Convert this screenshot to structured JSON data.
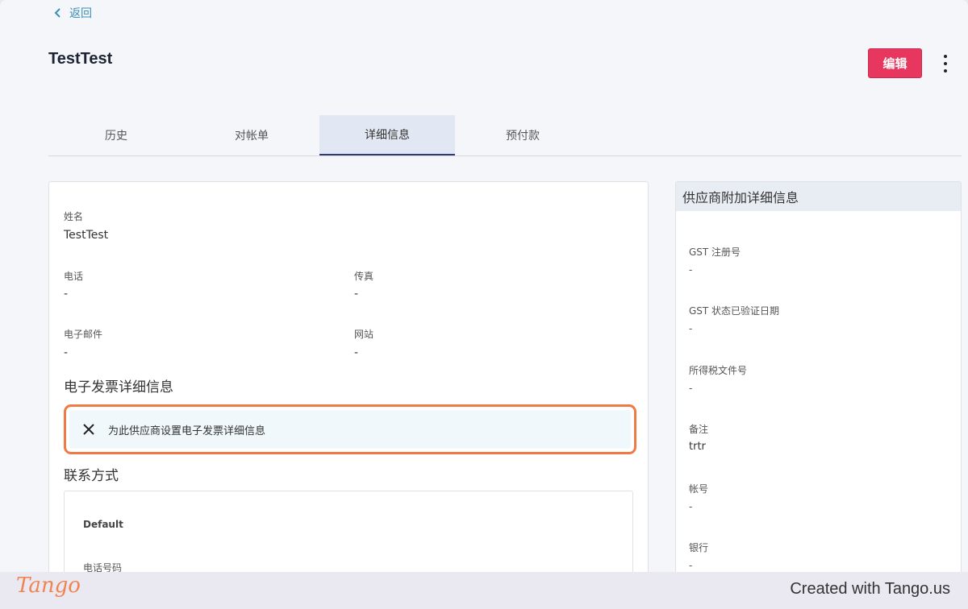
{
  "header": {
    "back_label": "返回",
    "title": "TestTest",
    "edit_label": "编辑"
  },
  "tabs": [
    {
      "label": "历史"
    },
    {
      "label": "对帐单"
    },
    {
      "label": "详细信息"
    },
    {
      "label": "预付款"
    }
  ],
  "details": {
    "name_label": "姓名",
    "name_value": "TestTest",
    "phone_label": "电话",
    "phone_value": "-",
    "fax_label": "传真",
    "fax_value": "-",
    "email_label": "电子邮件",
    "email_value": "-",
    "website_label": "网站",
    "website_value": "-",
    "einvoice_section": "电子发票详细信息",
    "einvoice_action": "为此供应商设置电子发票详细信息",
    "contact_section": "联系方式",
    "contact_default": "Default",
    "contact_phone_label": "电话号码"
  },
  "side": {
    "title": "供应商附加详细信息",
    "fields": [
      {
        "label": "GST 注册号",
        "value": "-"
      },
      {
        "label": "GST 状态已验证日期",
        "value": "-"
      },
      {
        "label": "所得税文件号",
        "value": "-"
      },
      {
        "label": "备注",
        "value": "trtr"
      },
      {
        "label": "帐号",
        "value": "-"
      },
      {
        "label": "银行",
        "value": "-"
      }
    ]
  },
  "footer": {
    "logo": "Tango",
    "credit": "Created with Tango.us"
  },
  "colors": {
    "accent": "#e8375f",
    "link": "#3a8fb7",
    "highlight": "#f07a45"
  }
}
